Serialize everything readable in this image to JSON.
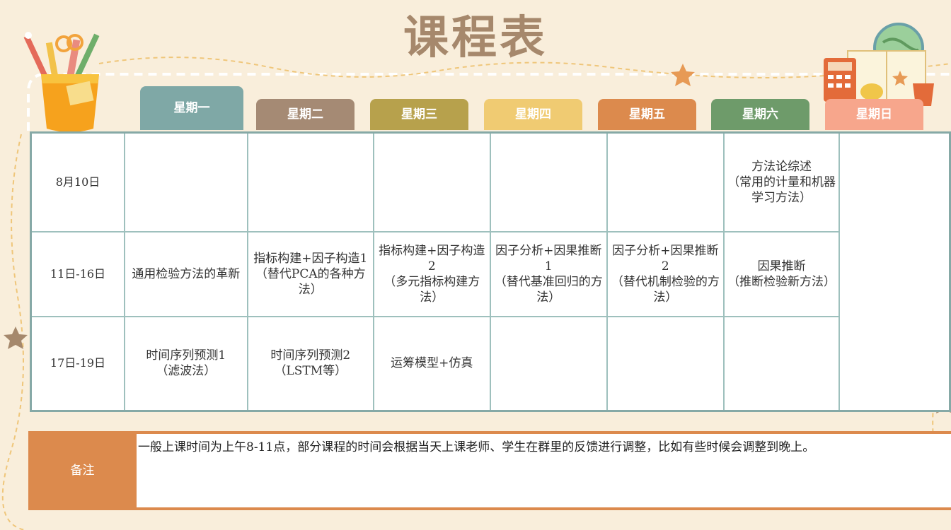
{
  "title": "课程表",
  "days": [
    {
      "label": "星期一",
      "color": "#7fa8a6"
    },
    {
      "label": "星期二",
      "color": "#a58a74"
    },
    {
      "label": "星期三",
      "color": "#b7a14c"
    },
    {
      "label": "星期四",
      "color": "#f0cb72"
    },
    {
      "label": "星期五",
      "color": "#dc8a4d"
    },
    {
      "label": "星期六",
      "color": "#6e9b6a"
    },
    {
      "label": "星期日",
      "color": "#f7a68c"
    }
  ],
  "rows": [
    {
      "date": "8月10日",
      "cells": [
        "",
        "",
        "",
        "",
        "",
        "方法论综述\n（常用的计量和机器\n学习方法）"
      ]
    },
    {
      "date": "11日-16日",
      "cells": [
        "通用检验方法的革新",
        "指标构建+因子构造1\n（替代PCA的各种方法）",
        "指标构建+因子构造2\n（多元指标构建方\n法）",
        "因子分析+因果推断1\n（替代基准回归的方\n法）",
        "因子分析+因果推断2\n（替代机制检验的方\n法）",
        "因果推断\n（推断检验新方法）"
      ]
    },
    {
      "date": "17日-19日",
      "cells": [
        "时间序列预测1\n（滤波法）",
        "时间序列预测2\n（LSTM等）",
        "运筹模型+仿真",
        "",
        "",
        ""
      ]
    }
  ],
  "note": {
    "label": "备注",
    "text": "一般上课时间为上午8-11点，部分课程的时间会根据当天上课老师、学生在群里的反馈进行调整，比如有些时候会调整到晚上。"
  }
}
